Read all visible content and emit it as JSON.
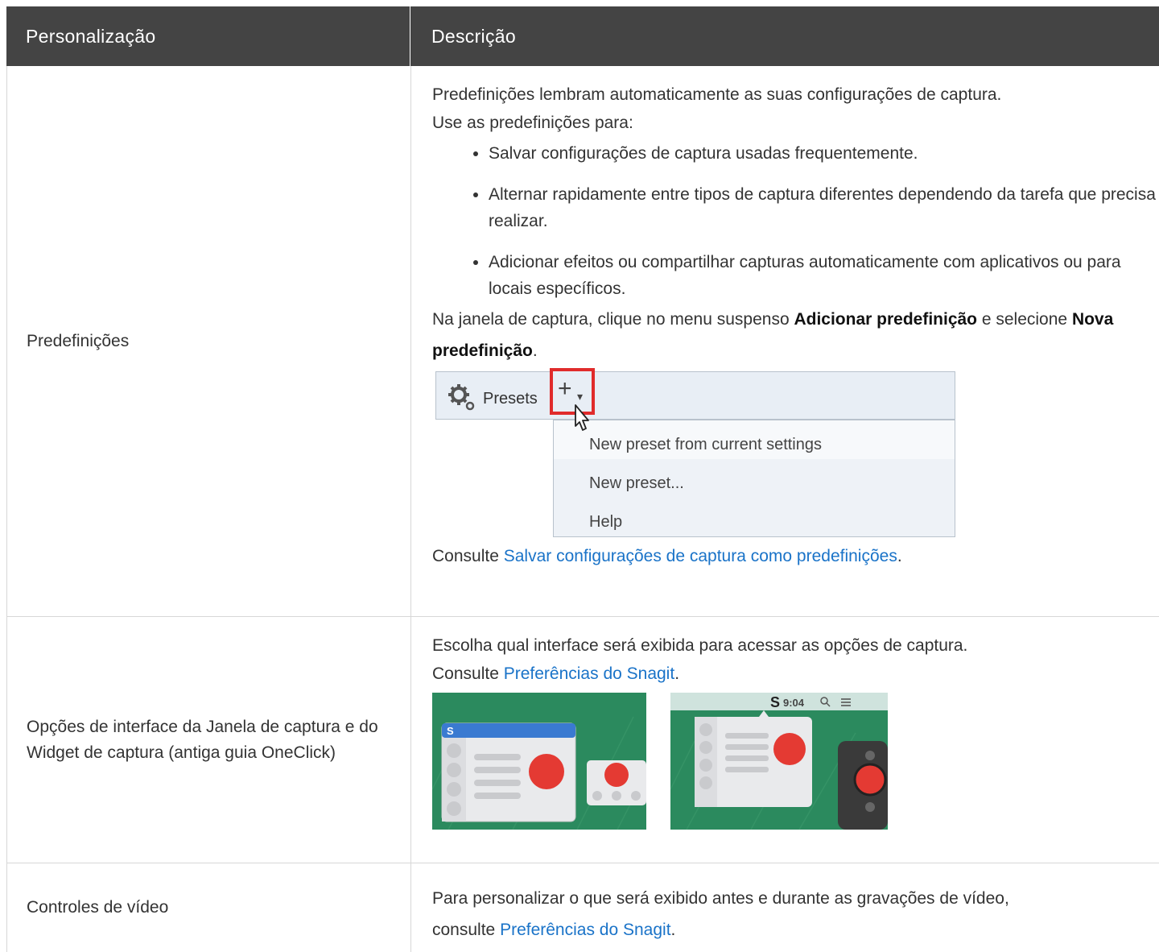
{
  "header": {
    "col1": "Personalização",
    "col2": "Descrição"
  },
  "rows": [
    {
      "label": "Predefinições",
      "intro1": "Predefinições lembram automaticamente as suas configurações de captura.",
      "intro2": "Use as predefinições para:",
      "bullets": [
        "Salvar configurações de captura usadas frequentemente.",
        "Alternar rapidamente entre tipos de captura diferentes dependendo da tarefa que precisa realizar.",
        "Adicionar efeitos ou compartilhar capturas automaticamente com aplicativos ou para locais específicos."
      ],
      "instr_pre": "Na janela de captura, clique no menu suspenso ",
      "instr_b1": "Adicionar predefinição",
      "instr_mid": " e selecione ",
      "instr_b2": "Nova predefinição",
      "instr_end": ".",
      "screenshot": {
        "presets_label": "Presets",
        "plus": "+",
        "caret": "▾",
        "menu_items": [
          "New preset from current settings",
          "New preset...",
          "Help"
        ]
      },
      "see_pre": "Consulte ",
      "see_link": "Salvar configurações de captura como predefinições",
      "see_end": "."
    },
    {
      "label": "Opções de interface da Janela de captura e do Widget de captura (antiga guia OneClick)",
      "text": "Escolha qual interface será exibida para acessar as opções de captura.",
      "see_pre": "Consulte ",
      "see_link": "Preferências do Snagit",
      "see_end": ".",
      "pic1": {
        "logo": "S"
      },
      "pic2": {
        "logo": "S",
        "time": "9:04"
      }
    },
    {
      "label": "Controles de vídeo",
      "text": "Para personalizar o que será exibido antes e durante as gravações de vídeo,",
      "see_pre": "consulte ",
      "see_link": "Preferências do Snagit",
      "see_end": "."
    }
  ],
  "colors": {
    "header_bg": "#444444",
    "link": "#1a73c8",
    "highlight": "#e02b2b",
    "scene_green": "#2b8a5e",
    "record_red": "#e43a33"
  }
}
